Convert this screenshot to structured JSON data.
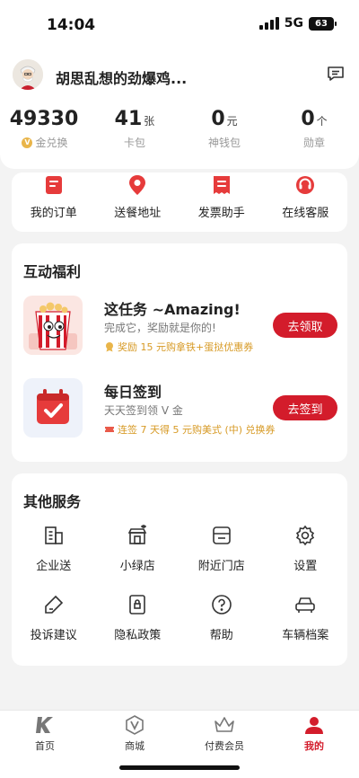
{
  "status_bar": {
    "time": "14:04",
    "network": "5G",
    "battery": "63"
  },
  "profile": {
    "username": "胡思乱想的劲爆鸡...",
    "stats": [
      {
        "value": "49330",
        "unit": "",
        "label": "金兑换"
      },
      {
        "value": "41",
        "unit": "张",
        "label": "卡包"
      },
      {
        "value": "0",
        "unit": "元",
        "label": "神钱包"
      },
      {
        "value": "0",
        "unit": "个",
        "label": "勋章"
      }
    ],
    "coin_symbol": "V"
  },
  "quick_actions": [
    {
      "label": "我的订单",
      "icon": "order-icon"
    },
    {
      "label": "送餐地址",
      "icon": "location-icon"
    },
    {
      "label": "发票助手",
      "icon": "invoice-icon"
    },
    {
      "label": "在线客服",
      "icon": "headset-icon"
    }
  ],
  "benefits": {
    "title": "互动福利",
    "tasks": [
      {
        "title": "这任务 ~Amazing!",
        "desc": "完成它，奖励就是你的!",
        "reward": "奖励 15 元购拿铁+蛋挞优惠券",
        "button": "去领取"
      },
      {
        "title": "每日签到",
        "desc": "天天签到领 V 金",
        "reward": "连签 7 天得 5 元购美式 (中) 兑换券",
        "button": "去签到"
      }
    ]
  },
  "services": {
    "title": "其他服务",
    "items": [
      {
        "label": "企业送",
        "icon": "building-icon"
      },
      {
        "label": "小绿店",
        "icon": "green-store-icon"
      },
      {
        "label": "附近门店",
        "icon": "nearby-store-icon"
      },
      {
        "label": "设置",
        "icon": "settings-icon"
      },
      {
        "label": "投诉建议",
        "icon": "feedback-icon"
      },
      {
        "label": "隐私政策",
        "icon": "privacy-icon"
      },
      {
        "label": "帮助",
        "icon": "help-icon"
      },
      {
        "label": "车辆档案",
        "icon": "car-icon"
      }
    ]
  },
  "bottom_nav": [
    {
      "label": "首页",
      "active": false
    },
    {
      "label": "商城",
      "active": false
    },
    {
      "label": "付费会员",
      "active": false
    },
    {
      "label": "我的",
      "active": true
    }
  ],
  "colors": {
    "accent": "#d31c2b",
    "gold": "#d79a25",
    "background": "#f3f3f3"
  }
}
